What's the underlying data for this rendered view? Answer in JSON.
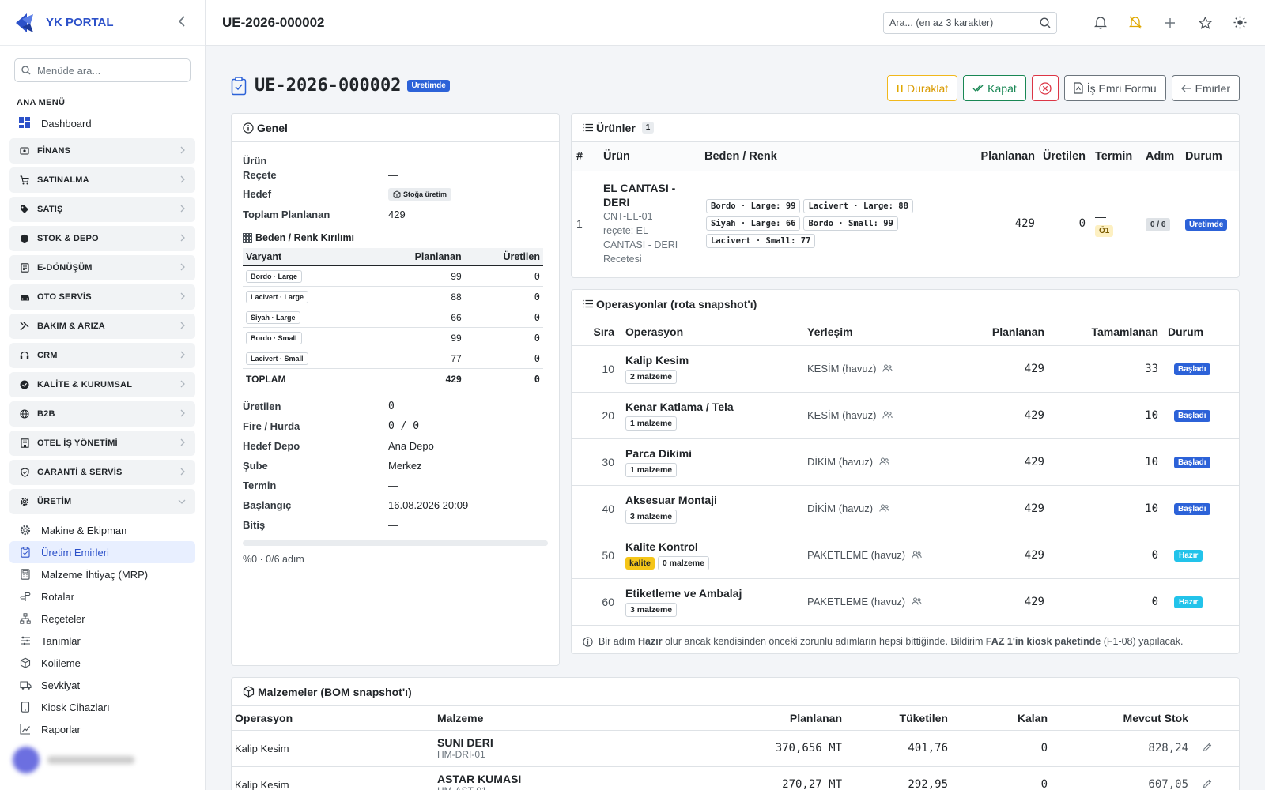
{
  "brand": {
    "name": "YK PORTAL",
    "accent": "#2c51c9"
  },
  "sidebar": {
    "search_placeholder": "Menüde ara...",
    "section": "ANA MENÜ",
    "dashboard": "Dashboard",
    "groups": [
      {
        "label": "FİNANS",
        "icon": "finance-icon"
      },
      {
        "label": "SATINALMA",
        "icon": "cart-icon"
      },
      {
        "label": "SATIŞ",
        "icon": "tag-icon"
      },
      {
        "label": "STOK & DEPO",
        "icon": "box-icon"
      },
      {
        "label": "E-DÖNÜŞÜM",
        "icon": "document-icon"
      },
      {
        "label": "OTO SERVİS",
        "icon": "car-icon"
      },
      {
        "label": "BAKIM & ARIZA",
        "icon": "tools-icon"
      },
      {
        "label": "CRM",
        "icon": "headset-icon"
      },
      {
        "label": "KALİTE & KURUMSAL",
        "icon": "badge-check-icon"
      },
      {
        "label": "B2B",
        "icon": "globe-icon"
      },
      {
        "label": "OTEL İŞ YÖNETİMİ",
        "icon": "building-icon"
      },
      {
        "label": "GARANTİ & SERVİS",
        "icon": "shield-icon"
      },
      {
        "label": "ÜRETİM",
        "icon": "gear-icon"
      }
    ],
    "production_items": [
      {
        "label": "Makine & Ekipman"
      },
      {
        "label": "Üretim Emirleri"
      },
      {
        "label": "Malzeme İhtiyaç (MRP)"
      },
      {
        "label": "Rotalar"
      },
      {
        "label": "Reçeteler"
      },
      {
        "label": "Tanımlar"
      },
      {
        "label": "Kolileme"
      },
      {
        "label": "Sevkiyat"
      },
      {
        "label": "Kiosk Cihazları"
      },
      {
        "label": "Raporlar"
      }
    ]
  },
  "topbar": {
    "title": "UE-2026-000002",
    "search_placeholder": "Ara... (en az 3 karakter)"
  },
  "page": {
    "title": "UE-2026-000002",
    "status": "Üretimde",
    "actions": {
      "pause": "Duraklat",
      "close": "Kapat",
      "form": "İş Emri Formu",
      "back": "Emirler"
    }
  },
  "general": {
    "title": "Genel",
    "urun_label": "Ürün",
    "recete_label": "Reçete",
    "recete_value": "—",
    "hedef_label": "Hedef",
    "hedef_value": "Stoğa üretim",
    "toplam_label": "Toplam Planlanan",
    "toplam_value": "429",
    "breakdown_title": "Beden / Renk Kırılımı",
    "breakdown_headers": {
      "variant": "Varyant",
      "planned": "Planlanan",
      "produced": "Üretilen"
    },
    "breakdown": [
      {
        "variant": "Bordo · Large",
        "planned": "99",
        "produced": "0"
      },
      {
        "variant": "Lacivert · Large",
        "planned": "88",
        "produced": "0"
      },
      {
        "variant": "Siyah · Large",
        "planned": "66",
        "produced": "0"
      },
      {
        "variant": "Bordo · Small",
        "planned": "99",
        "produced": "0"
      },
      {
        "variant": "Lacivert · Small",
        "planned": "77",
        "produced": "0"
      }
    ],
    "breakdown_total": {
      "label": "TOPLAM",
      "planned": "429",
      "produced": "0"
    },
    "uretilen_label": "Üretilen",
    "uretilen_value": "0",
    "fire_label": "Fire / Hurda",
    "fire_value": "0 / 0",
    "depo_label": "Hedef Depo",
    "depo_value": "Ana Depo",
    "sube_label": "Şube",
    "sube_value": "Merkez",
    "termin_label": "Termin",
    "termin_value": "—",
    "baslangic_label": "Başlangıç",
    "baslangic_value": "16.08.2026 20:09",
    "bitis_label": "Bitiş",
    "bitis_value": "—",
    "progress_fraction": 0,
    "progress_text": "%0 · 0/6 adım"
  },
  "products": {
    "title": "Ürünler",
    "count": "1",
    "headers": {
      "no": "#",
      "product": "Ürün",
      "size": "Beden / Renk",
      "planned": "Planlanan",
      "produced": "Üretilen",
      "deadline": "Termin",
      "step": "Adım",
      "status": "Durum"
    },
    "rows": [
      {
        "no": "1",
        "name_line1": "EL CANTASI -",
        "name_line2": "DERI",
        "code": "CNT-EL-01",
        "recipe_line1": "reçete: EL",
        "recipe_line2": "CANTASI - DERI",
        "recipe_line3": "Recetesi",
        "sizes": [
          "Bordo · Large: 99",
          "Lacivert · Large: 88",
          "Siyah · Large: 66",
          "Bordo · Small: 99",
          "Lacivert · Small: 77"
        ],
        "planned": "429",
        "produced": "0",
        "deadline": "—",
        "priority": "Ö1",
        "step": "0 / 6",
        "status": "Üretimde"
      }
    ]
  },
  "operations": {
    "title": "Operasyonlar (rota snapshot'ı)",
    "headers": {
      "seq": "Sıra",
      "op": "Operasyon",
      "loc": "Yerleşim",
      "planned": "Planlanan",
      "done": "Tamamlanan",
      "status": "Durum"
    },
    "rows": [
      {
        "seq": "10",
        "name": "Kalip Kesim",
        "materials": "2 malzeme",
        "quality": "",
        "loc": "KESİM (havuz)",
        "planned": "429",
        "done": "33",
        "status": "Başladı",
        "status_type": "started"
      },
      {
        "seq": "20",
        "name": "Kenar Katlama / Tela",
        "materials": "1 malzeme",
        "quality": "",
        "loc": "KESİM (havuz)",
        "planned": "429",
        "done": "10",
        "status": "Başladı",
        "status_type": "started"
      },
      {
        "seq": "30",
        "name": "Parca Dikimi",
        "materials": "1 malzeme",
        "quality": "",
        "loc": "DİKİM (havuz)",
        "planned": "429",
        "done": "10",
        "status": "Başladı",
        "status_type": "started"
      },
      {
        "seq": "40",
        "name": "Aksesuar Montaji",
        "materials": "3 malzeme",
        "quality": "",
        "loc": "DİKİM (havuz)",
        "planned": "429",
        "done": "10",
        "status": "Başladı",
        "status_type": "started"
      },
      {
        "seq": "50",
        "name": "Kalite Kontrol",
        "materials": "0 malzeme",
        "quality": "kalite",
        "loc": "PAKETLEME (havuz)",
        "planned": "429",
        "done": "0",
        "status": "Hazır",
        "status_type": "ready"
      },
      {
        "seq": "60",
        "name": "Etiketleme ve Ambalaj",
        "materials": "3 malzeme",
        "quality": "",
        "loc": "PAKETLEME (havuz)",
        "planned": "429",
        "done": "0",
        "status": "Hazır",
        "status_type": "ready"
      }
    ],
    "note_pre": "Bir adım ",
    "note_b1": "Hazır",
    "note_mid": " olur ancak kendisinden önceki zorunlu adımların hepsi bittiğinde. Bildirim ",
    "note_b2": "FAZ 1'in kiosk paketinde",
    "note_post": " (F1-08) yapılacak."
  },
  "materials": {
    "title": "Malzemeler (BOM snapshot'ı)",
    "headers": {
      "op": "Operasyon",
      "material": "Malzeme",
      "planned": "Planlanan",
      "consumed": "Tüketilen",
      "remaining": "Kalan",
      "stock": "Mevcut Stok"
    },
    "rows": [
      {
        "op": "Kalip Kesim",
        "name": "SUNI DERI",
        "code": "HM-DRI-01",
        "planned": "370,656 MT",
        "consumed": "401,76",
        "remaining": "0",
        "stock": "828,24"
      },
      {
        "op": "Kalip Kesim",
        "name": "ASTAR KUMASI",
        "code": "HM-AST-01",
        "planned": "270,27 MT",
        "consumed": "292,95",
        "remaining": "0",
        "stock": "607,05"
      }
    ]
  },
  "colors": {
    "primary": "#2c62d8",
    "ready": "#22c3ea",
    "warning": "#f1b81c",
    "success": "#198754",
    "danger": "#dc3545"
  }
}
